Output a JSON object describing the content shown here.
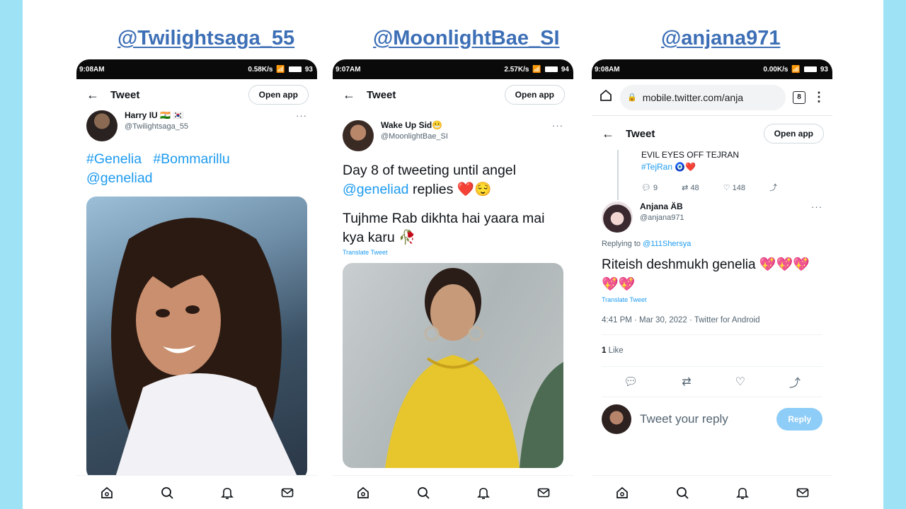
{
  "headers": {
    "h1": "@Twilightsaga_55",
    "h2": "@MoonlightBae_SI",
    "h3": "@anjana971"
  },
  "phone1": {
    "status": {
      "time": "9:08AM",
      "speed": "0.58K/s",
      "battery": "93"
    },
    "appbar": {
      "title": "Tweet",
      "open_app": "Open app"
    },
    "author": {
      "name": "Harry IU 🇮🇳 🇰🇷",
      "username": "@Twilightsaga_55"
    },
    "hashtag1": "#Genelia",
    "hashtag2": "#Bommarillu",
    "mention": "@geneliad",
    "photo_alt": "Portrait photo of a smiling woman with curly hair"
  },
  "phone2": {
    "status": {
      "time": "9:07AM",
      "speed": "2.57K/s",
      "battery": "94"
    },
    "appbar": {
      "title": "Tweet",
      "open_app": "Open app"
    },
    "author": {
      "name": "Wake Up Sid😬",
      "username": "@MoonlightBae_SI"
    },
    "line1": "Day 8 of tweeting until angel",
    "mention": "@geneliad",
    "line2_rest": " replies ❤️😌",
    "line3": "Tujhme Rab dikhta hai yaara mai kya karu 🥀",
    "translate": "Translate Tweet",
    "photo_alt": "Photo of a woman in a yellow outfit"
  },
  "phone3": {
    "status": {
      "time": "9:08AM",
      "speed": "0.00K/s",
      "battery": "93"
    },
    "browser": {
      "url": "mobile.twitter.com/anja",
      "tabs": "8"
    },
    "appbar": {
      "title": "Tweet",
      "open_app": "Open app"
    },
    "parent": {
      "text": "EVIL EYES OFF TEJRAN",
      "hashtag": "#TejRan",
      "emoji": "🧿❤️",
      "replies": "9",
      "retweets": "48",
      "likes": "148"
    },
    "author": {
      "name": "Anjana ÄB",
      "username": "@anjana971"
    },
    "replying_prefix": "Replying to ",
    "replying_to": "@111Shersya",
    "tweet_text": "Riteish deshmukh genelia 💖💖💖💖💖",
    "translate": "Translate Tweet",
    "meta": "4:41 PM · Mar 30, 2022 · Twitter for Android",
    "likes_count": "1",
    "likes_label": " Like",
    "reply_placeholder": "Tweet your reply",
    "reply_button": "Reply"
  }
}
